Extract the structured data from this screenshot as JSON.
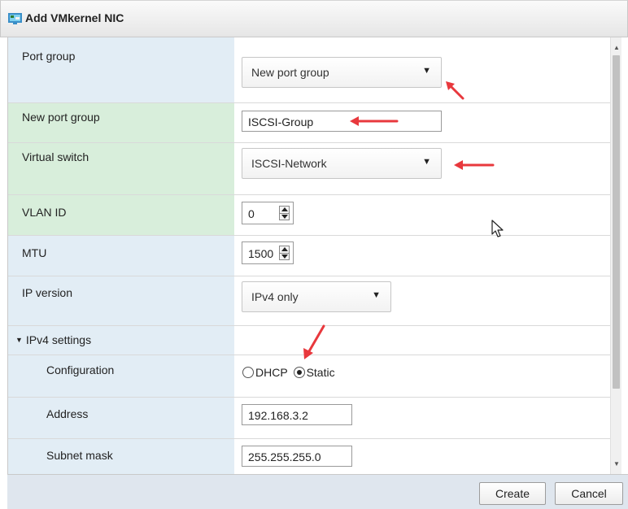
{
  "window": {
    "title": "Add VMkernel NIC"
  },
  "form": {
    "port_group": {
      "label": "Port group",
      "value": "New port group"
    },
    "new_port_group": {
      "label": "New port group",
      "value": "ISCSI-Group"
    },
    "virtual_switch": {
      "label": "Virtual switch",
      "value": "ISCSI-Network"
    },
    "vlan_id": {
      "label": "VLAN ID",
      "value": "0"
    },
    "mtu": {
      "label": "MTU",
      "value": "1500"
    },
    "ip_version": {
      "label": "IP version",
      "value": "IPv4 only"
    },
    "ipv4_settings": {
      "label": "IPv4 settings"
    },
    "configuration": {
      "label": "Configuration",
      "options": [
        "DHCP",
        "Static"
      ],
      "selected": "Static"
    },
    "address": {
      "label": "Address",
      "value": "192.168.3.2"
    },
    "subnet_mask": {
      "label": "Subnet mask",
      "value": "255.255.255.0"
    }
  },
  "buttons": {
    "create": "Create",
    "cancel": "Cancel"
  },
  "colors": {
    "annotation_arrow": "#e8383d",
    "label_bg": "#e2edf5",
    "required_label_bg": "#d8eedb",
    "footer_bg": "#dfe6ee"
  },
  "icons": {
    "title": "vmkernel-nic-icon",
    "dropdown": "triangle-down-icon",
    "cursor": "mouse-pointer-icon"
  }
}
